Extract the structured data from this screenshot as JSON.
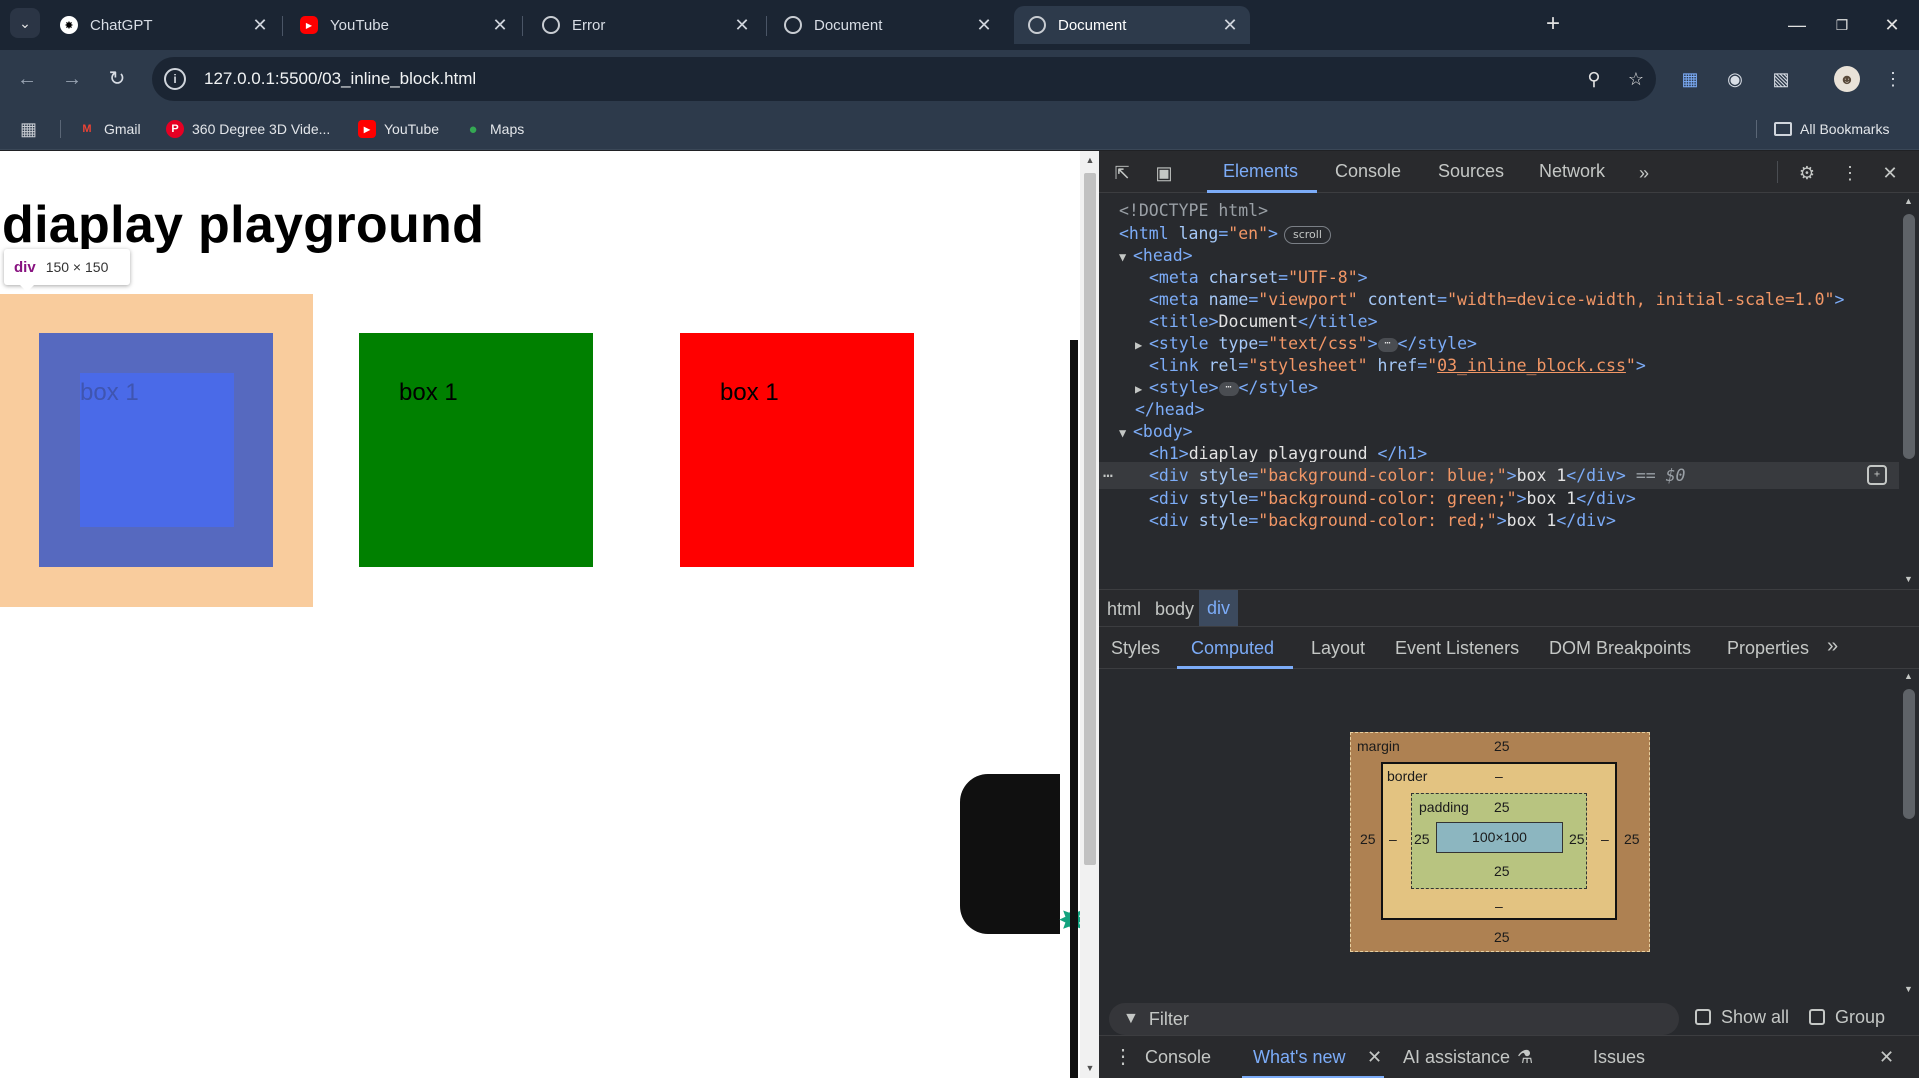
{
  "tabs": [
    {
      "title": "ChatGPT",
      "icon": "chatgpt-icon",
      "active": false
    },
    {
      "title": "YouTube",
      "icon": "youtube-icon",
      "active": false
    },
    {
      "title": "Error",
      "icon": "globe-icon",
      "active": false
    },
    {
      "title": "Document",
      "icon": "globe-icon",
      "active": false
    },
    {
      "title": "Document",
      "icon": "globe-icon",
      "active": true
    }
  ],
  "address": {
    "url": "127.0.0.1:5500/03_inline_block.html"
  },
  "bookmarks": [
    {
      "label": "Gmail"
    },
    {
      "label": "360 Degree 3D Vide..."
    },
    {
      "label": "YouTube"
    },
    {
      "label": "Maps"
    }
  ],
  "all_bookmarks": "All Bookmarks",
  "page": {
    "heading": "diaplay playground",
    "tooltip": {
      "tag": "div",
      "size": "150 × 150"
    },
    "boxes": [
      {
        "label": "box 1",
        "color": "#0000ff"
      },
      {
        "label": "box 1",
        "color": "#008000"
      },
      {
        "label": "box 1",
        "color": "#ff0000"
      }
    ]
  },
  "devtools": {
    "tabs": [
      "Elements",
      "Console",
      "Sources",
      "Network"
    ],
    "active_tab": "Elements",
    "dom": {
      "doctype": "<!DOCTYPE html>",
      "html_open": "<html",
      "html_lang_attr": "lang",
      "html_lang_val": "\"en\"",
      "scroll_badge": "scroll",
      "head_open": "<head>",
      "meta_charset_tag": "<meta",
      "meta_charset_attr": "charset",
      "meta_charset_val": "\"UTF-8\"",
      "meta_vp_name_attr": "name",
      "meta_vp_name_val": "\"viewport\"",
      "meta_vp_content_attr": "content",
      "meta_vp_content_val": "\"width=device-width, initial-scale=1.0\"",
      "title_open": "<title>",
      "title_text": "Document",
      "title_close": "</title>",
      "style_open": "<style",
      "style_type_attr": "type",
      "style_type_val": "\"text/css\"",
      "style_close": "</style>",
      "link_open": "<link",
      "link_rel_attr": "rel",
      "link_rel_val": "\"stylesheet\"",
      "link_href_attr": "href",
      "link_href_val": "03_inline_block.css",
      "style2_open": "<style>",
      "head_close": "</head>",
      "body_open": "<body>",
      "h1_open": "<h1>",
      "h1_text": "diaplay playground ",
      "h1_close": "</h1>",
      "div1_attr_val": "\"background-color: blue;\"",
      "div_text": "box 1",
      "div_close": "</div>",
      "selected_marker": "== $0",
      "div2_attr_val": "\"background-color: green;\"",
      "div3_attr_val": "\"background-color: red;\""
    },
    "breadcrumbs": [
      "html",
      "body",
      "div"
    ],
    "sub_tabs": [
      "Styles",
      "Computed",
      "Layout",
      "Event Listeners",
      "DOM Breakpoints",
      "Properties"
    ],
    "active_sub_tab": "Computed",
    "box_model": {
      "margin_label": "margin",
      "border_label": "border",
      "padding_label": "padding",
      "margin": {
        "top": "25",
        "right": "25",
        "bottom": "25",
        "left": "25"
      },
      "border": {
        "top": "–",
        "right": "–",
        "bottom": "–",
        "left": "–"
      },
      "padding": {
        "top": "25",
        "right": "25",
        "bottom": "25",
        "left": "25"
      },
      "content": "100×100"
    },
    "filter_placeholder": "Filter",
    "show_all": "Show all",
    "group": "Group",
    "drawer_tabs": [
      "Console",
      "What's new",
      "AI assistance",
      "Issues"
    ],
    "active_drawer_tab": "What's new"
  }
}
